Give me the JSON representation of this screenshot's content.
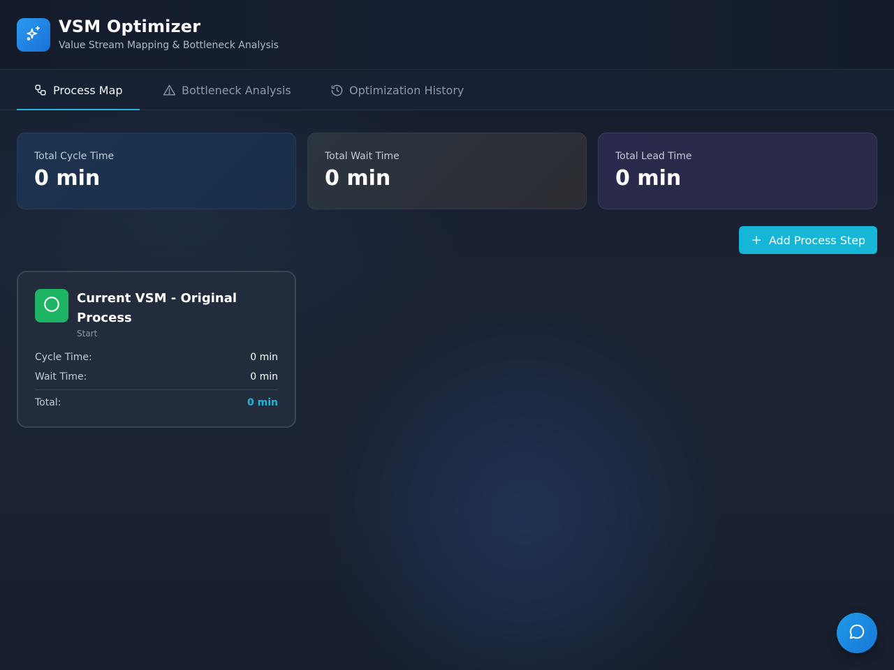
{
  "app": {
    "title": "VSM Optimizer",
    "subtitle": "Value Stream Mapping & Bottleneck Analysis",
    "logo_icon": "sparkles-icon"
  },
  "tabs": [
    {
      "label": "Process Map",
      "icon": "process-map-icon",
      "active": true
    },
    {
      "label": "Bottleneck Analysis",
      "icon": "warning-triangle-icon",
      "active": false
    },
    {
      "label": "Optimization History",
      "icon": "history-icon",
      "active": false
    }
  ],
  "stats": [
    {
      "label": "Total Cycle Time",
      "value": "0 min"
    },
    {
      "label": "Total Wait Time",
      "value": "0 min"
    },
    {
      "label": "Total Lead Time",
      "value": "0 min"
    }
  ],
  "actions": {
    "add_step_label": "Add Process Step"
  },
  "process_steps": [
    {
      "title": "Current VSM - Original Process",
      "type": "Start",
      "icon": "circle-icon",
      "cycle_label": "Cycle Time:",
      "cycle_value": "0 min",
      "wait_label": "Wait Time:",
      "wait_value": "0 min",
      "total_label": "Total:",
      "total_value": "0 min"
    }
  ],
  "chat": {
    "icon": "chat-bubble-icon"
  },
  "colors": {
    "accent": "#1fb6d8",
    "logo_bg": "#1b84e6",
    "start_green": "#1db463",
    "button_bg": "#16b6d6"
  }
}
